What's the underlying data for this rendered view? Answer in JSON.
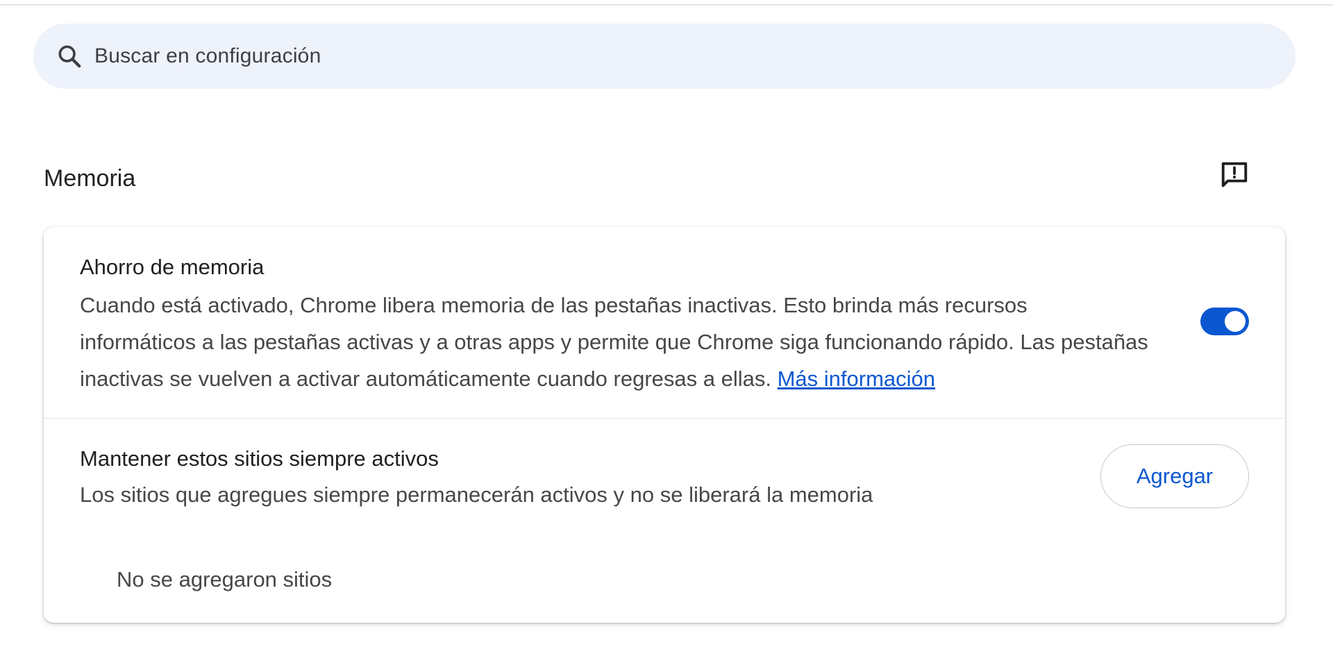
{
  "search": {
    "placeholder": "Buscar en configuración"
  },
  "section": {
    "title": "Memoria"
  },
  "memory_saver": {
    "title": "Ahorro de memoria",
    "description": "Cuando está activado, Chrome libera memoria de las pestañas inactivas. Esto brinda más recursos informáticos a las pestañas activas y a otras apps y permite que Chrome siga funcionando rápido. Las pestañas inactivas se vuelven a activar automáticamente cuando regresas a ellas.",
    "link_label": "Más información",
    "toggle_on": true
  },
  "always_active": {
    "title": "Mantener estos sitios siempre activos",
    "description": "Los sitios que agregues siempre permanecerán activos y no se liberará la memoria",
    "add_label": "Agregar",
    "empty_label": "No se agregaron sitios"
  },
  "icons": {
    "search": "search-icon",
    "feedback": "feedback-icon"
  },
  "colors": {
    "accent": "#0b57d0",
    "search_bg": "#eef2fb"
  }
}
